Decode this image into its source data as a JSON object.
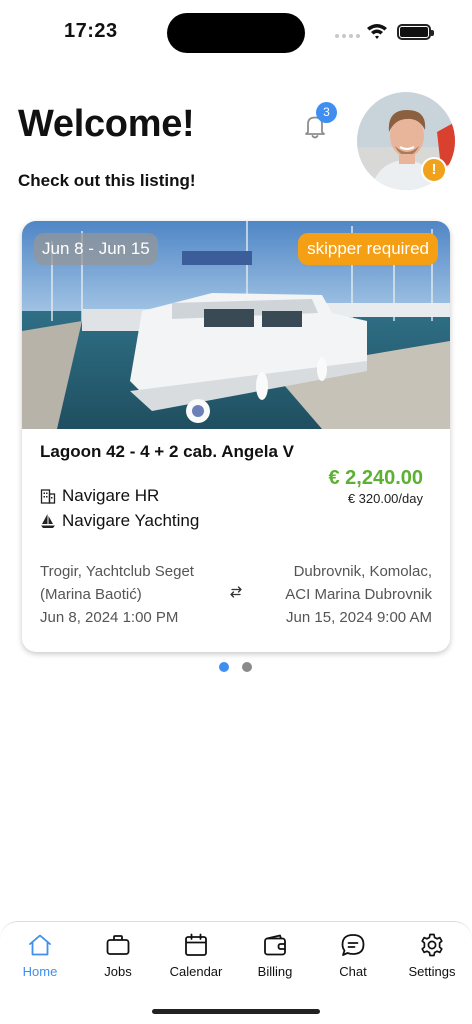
{
  "status_bar": {
    "time": "17:23"
  },
  "header": {
    "title": "Welcome!",
    "subtitle": "Check out this listing!",
    "notification_count": "3",
    "avatar_alert": "!"
  },
  "listing": {
    "date_range": "Jun 8 - Jun 15",
    "tag": "skipper required",
    "name": "Lagoon 42 - 4 + 2 cab. Angela V",
    "price": "€ 2,240.00",
    "price_per_day": "€ 320.00/day",
    "company": "Navigare HR",
    "agency": "Navigare Yachting",
    "departure": {
      "line1": "Trogir, Yachtclub Seget",
      "line2": "(Marina Baotić)",
      "datetime": "Jun 8, 2024 1:00 PM"
    },
    "arrival": {
      "line1": "Dubrovnik, Komolac,",
      "line2": "ACI Marina Dubrovnik",
      "datetime": "Jun 15, 2024 9:00 AM"
    }
  },
  "pager": {
    "pages": 2,
    "active": 0
  },
  "tab_bar": {
    "items": [
      {
        "label": "Home",
        "icon": "house-icon",
        "active": true
      },
      {
        "label": "Jobs",
        "icon": "briefcase-icon",
        "active": false
      },
      {
        "label": "Calendar",
        "icon": "calendar-icon",
        "active": false
      },
      {
        "label": "Billing",
        "icon": "wallet-icon",
        "active": false
      },
      {
        "label": "Chat",
        "icon": "chat-bubble-icon",
        "active": false
      },
      {
        "label": "Settings",
        "icon": "gear-icon",
        "active": false
      }
    ]
  },
  "colors": {
    "accent": "#3f8ef0",
    "price": "#5cb032",
    "tag": "#f5a014"
  }
}
